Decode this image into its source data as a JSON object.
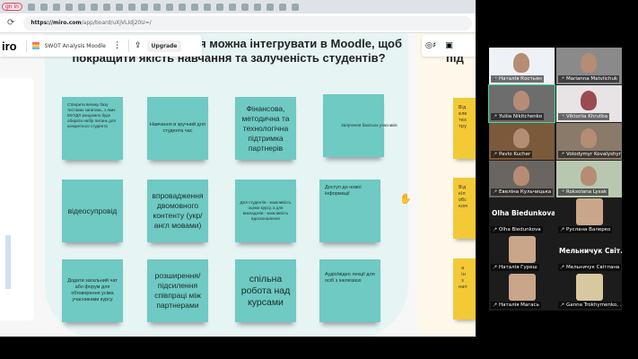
{
  "browser": {
    "sign_in": "gn in",
    "url_host": "https://miro.com",
    "url_path": "/app/board/uXjVLIdj20U=/"
  },
  "miro": {
    "logo": "iro",
    "board_name": "SWOT Analysis Moodle",
    "upgrade": "Upgrade"
  },
  "frame_title": "...ції або методи навчання можна інтегрувати в Moodle, щоб покращити якість навчання та залученість студентів?",
  "yellow_title": "під",
  "stickies": [
    "Створити велику базу тестових запитань, з яких МУУДЛ рандомно буде обирати набір питань для конкретного студента",
    "Навчання в зручний для студента час",
    "Фінансова, методична та технологічна підтримка партнерів",
    "Залучення багатьох учасників",
    "відеосупровід",
    "впровадження двомовного контенту (укр/англ мовами)",
    "Для студентів - можливість оцінки курсу, а для викладачів - можливість вдосконалення",
    "Доступ до нової інформації",
    "Додати загальний чат або форум для обговорення усіма учасниками курсу",
    "розширення/ підсилення співпраці між партнерами",
    "спільна робота над курсами",
    "Аудіо/відео лекції для осіб з інклюзією"
  ],
  "yellow_stickies": [
    "Від\nеле\nтех\nтру",
    "Від\nкіл\nобс\nком",
    "  а\n  ін\n  з\nнап"
  ],
  "participants": [
    {
      "name": "Наталія Костьян"
    },
    {
      "name": "Marianna Matviichuk"
    },
    {
      "name": "Yuliia Nikitchenko"
    },
    {
      "name": "Viktoriia Khrutba"
    },
    {
      "name": "Pavlo Kucher"
    },
    {
      "name": "Volodymyr Kovalyshyn"
    },
    {
      "name": "Евеліна Кульчицька"
    },
    {
      "name": "Roksolana Lysak"
    },
    {
      "name": "Olha Biedunkova",
      "display": "Olha Biedunkova"
    },
    {
      "name": "Руслана Валерко"
    },
    {
      "name": "Наталія Гуреш"
    },
    {
      "name": "Мельничук Світлана",
      "display": "Мельничук Світ..."
    },
    {
      "name": "Наталія Магась"
    },
    {
      "name": "Ganna Trokhymenko, ..."
    }
  ],
  "colors": {
    "sticky_teal": "#6ecac3",
    "sticky_yellow": "#f3c935",
    "active_speaker": "#3ddc97"
  }
}
